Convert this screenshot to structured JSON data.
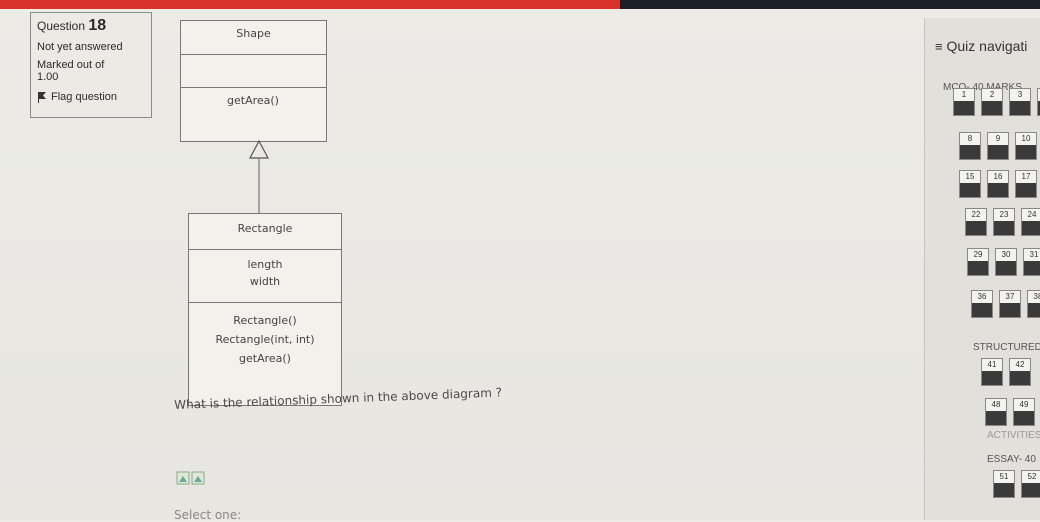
{
  "question": {
    "number_label": "Question",
    "number": "18",
    "state": "Not yet answered",
    "marked_label": "Marked out of",
    "marked_value": "1.00",
    "flag_label": "Flag question",
    "text": "What is the relationship shown in the above diagram ?",
    "select_label": "Select one:"
  },
  "diagram": {
    "parent": {
      "name": "Shape",
      "attributes": "",
      "methods": [
        "getArea()"
      ]
    },
    "child": {
      "name": "Rectangle",
      "attributes": [
        "length",
        "width"
      ],
      "methods": [
        "Rectangle()",
        "Rectangle(int, int)",
        "getArea()"
      ]
    }
  },
  "nav": {
    "title": "Quiz navigati",
    "sections": [
      {
        "label": "MCQ- 40 MARKS"
      },
      {
        "label": "STRUCTURED"
      },
      {
        "label": "ACTIVITIES"
      },
      {
        "label": "ESSAY- 40"
      }
    ],
    "rows": [
      [
        "1",
        "2",
        "3",
        ""
      ],
      [
        "8",
        "9",
        "10",
        ""
      ],
      [
        "15",
        "16",
        "17"
      ],
      [
        "22",
        "23",
        "24"
      ],
      [
        "29",
        "30",
        "31"
      ],
      [
        "36",
        "37",
        "38"
      ],
      [
        "41",
        "42"
      ],
      [
        "48",
        "49"
      ],
      [
        "51",
        "52"
      ]
    ]
  },
  "colors": {
    "accent_red": "#d9312b",
    "answered": "#3a3a3a"
  }
}
